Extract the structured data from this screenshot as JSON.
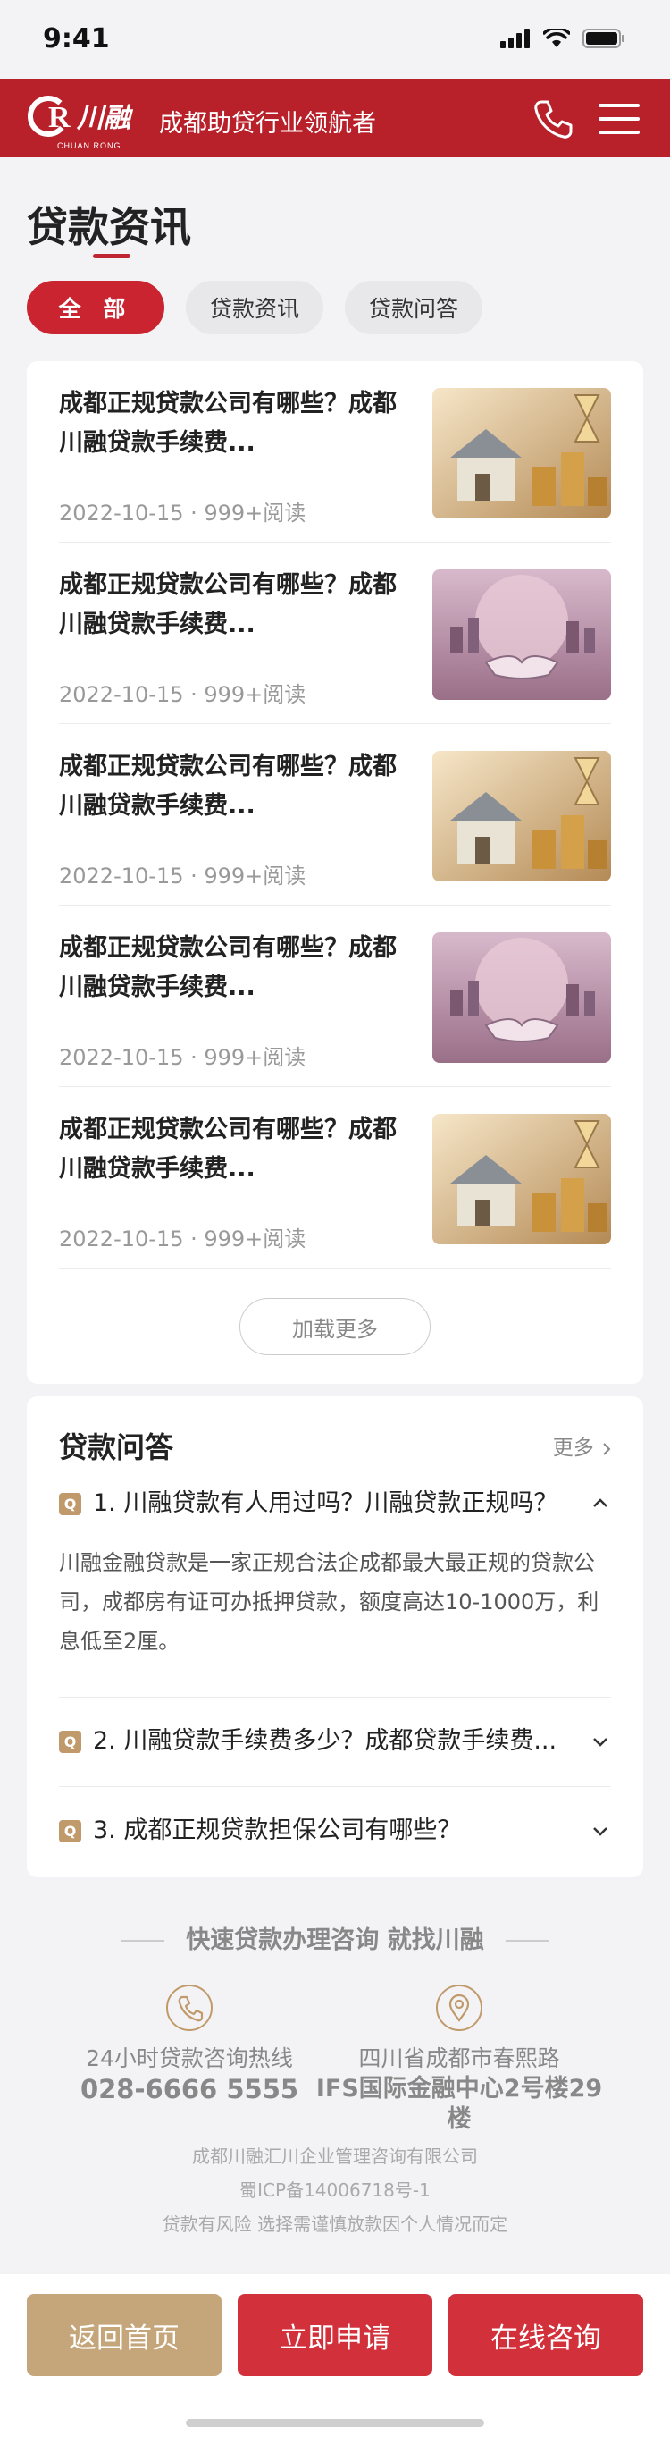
{
  "status_bar": {
    "time": "9:41"
  },
  "header": {
    "logo_text": "川融",
    "logo_sub": "CHUAN RONG",
    "slogan": "成都助贷行业领航者"
  },
  "page": {
    "title": "贷款资讯"
  },
  "tabs": [
    {
      "label": "全 部",
      "active": true
    },
    {
      "label": "贷款资讯",
      "active": false
    },
    {
      "label": "贷款问答",
      "active": false
    }
  ],
  "news": [
    {
      "title": "成都正规贷款公司有哪些？成都川融贷款手续费...",
      "date": "2022-10-15",
      "reads": "999+阅读",
      "thumb": "house-coins"
    },
    {
      "title": "成都正规贷款公司有哪些？成都川融贷款手续费...",
      "date": "2022-10-15",
      "reads": "999+阅读",
      "thumb": "handshake-globe"
    },
    {
      "title": "成都正规贷款公司有哪些？成都川融贷款手续费...",
      "date": "2022-10-15",
      "reads": "999+阅读",
      "thumb": "house-coins"
    },
    {
      "title": "成都正规贷款公司有哪些？成都川融贷款手续费...",
      "date": "2022-10-15",
      "reads": "999+阅读",
      "thumb": "handshake-globe"
    },
    {
      "title": "成都正规贷款公司有哪些？成都川融贷款手续费...",
      "date": "2022-10-15",
      "reads": "999+阅读",
      "thumb": "house-coins"
    }
  ],
  "load_more": "加载更多",
  "qa": {
    "title": "贷款问答",
    "more": "更多",
    "items": [
      {
        "badge": "Q",
        "question": "1. 川融贷款有人用过吗？川融贷款正规吗？",
        "expanded": true,
        "answer": "川融金融贷款是一家正规合法企成都最大最正规的贷款公司，成都房有证可办抵押贷款，额度高达10-1000万，利息低至2厘。"
      },
      {
        "badge": "Q",
        "question": "2. 川融贷款手续费多少？成都贷款手续费...",
        "expanded": false
      },
      {
        "badge": "Q",
        "question": "3. 成都正规贷款担保公司有哪些？",
        "expanded": false
      }
    ]
  },
  "contact": {
    "headline": "快速贷款办理咨询 就找川融",
    "hotline_label": "24小时贷款咨询热线",
    "hotline_number": "028-6666 5555",
    "address_line1": "四川省成都市春熙路",
    "address_line2": "IFS国际金融中心2号楼29楼"
  },
  "footer": {
    "company": "成都川融汇川企业管理咨询有限公司",
    "icp": "蜀ICP备14006718号-1",
    "risk": "贷款有风险  选择需谨慎放款因个人情况而定"
  },
  "bottom_actions": {
    "home": "返回首页",
    "apply": "立即申请",
    "consult": "在线咨询"
  },
  "colors": {
    "brand_red": "#b8202a",
    "accent_gold": "#c09a6b",
    "page_bg": "#f3f3f5"
  }
}
